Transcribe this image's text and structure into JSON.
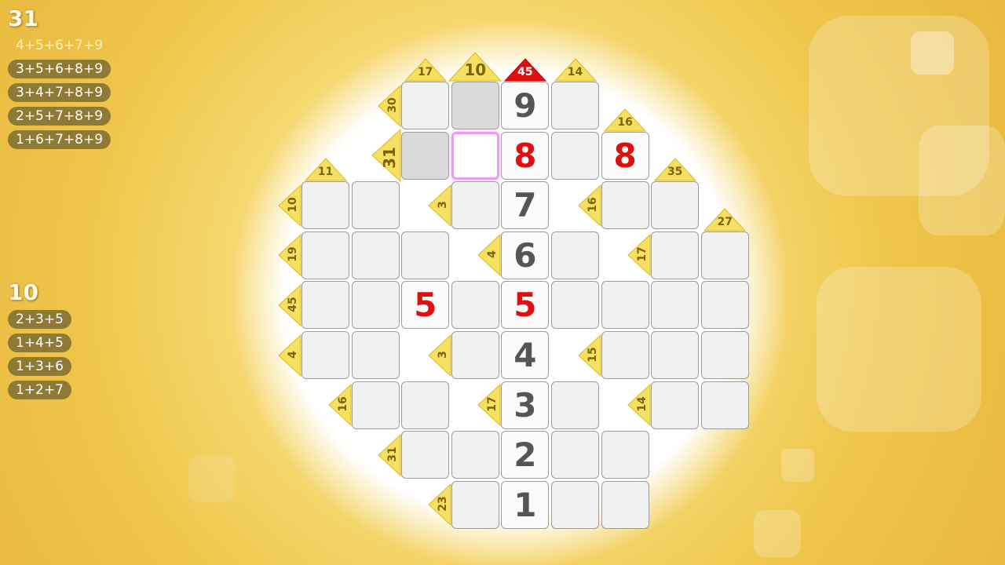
{
  "colors": {
    "clue_fill": "#f7df5f",
    "clue_highlight_fill": "#e01010",
    "cell_fill": "#f1f1f1",
    "cell_shaded": "#dadada",
    "cell_selected_border": "#e99cf2",
    "digit_red": "#e01010",
    "digit_gray": "#555555",
    "combo_pill": "#8e7a34"
  },
  "panels": [
    {
      "title": "31",
      "combos": [
        {
          "text": "4+5+6+7+9",
          "excluded": true
        },
        {
          "text": "3+5+6+8+9",
          "excluded": false
        },
        {
          "text": "3+4+7+8+9",
          "excluded": false
        },
        {
          "text": "2+5+7+8+9",
          "excluded": false
        },
        {
          "text": "1+6+7+8+9",
          "excluded": false
        }
      ]
    },
    {
      "title": "10",
      "combos": [
        {
          "text": "2+3+5",
          "excluded": false
        },
        {
          "text": "1+4+5",
          "excluded": false
        },
        {
          "text": "1+3+6",
          "excluded": false
        },
        {
          "text": "1+2+7",
          "excluded": false
        }
      ]
    }
  ],
  "cells": [
    {
      "r": 0,
      "c": 2,
      "v": "",
      "state": "empty"
    },
    {
      "r": 0,
      "c": 3,
      "v": "",
      "state": "shaded"
    },
    {
      "r": 0,
      "c": 4,
      "v": "9",
      "state": "gray"
    },
    {
      "r": 0,
      "c": 5,
      "v": "",
      "state": "empty"
    },
    {
      "r": 1,
      "c": 2,
      "v": "",
      "state": "shaded"
    },
    {
      "r": 1,
      "c": 3,
      "v": "",
      "state": "selected"
    },
    {
      "r": 1,
      "c": 4,
      "v": "8",
      "state": "red"
    },
    {
      "r": 1,
      "c": 5,
      "v": "",
      "state": "empty"
    },
    {
      "r": 1,
      "c": 6,
      "v": "8",
      "state": "red"
    },
    {
      "r": 2,
      "c": 0,
      "v": "",
      "state": "empty"
    },
    {
      "r": 2,
      "c": 1,
      "v": "",
      "state": "empty"
    },
    {
      "r": 2,
      "c": 3,
      "v": "",
      "state": "empty"
    },
    {
      "r": 2,
      "c": 4,
      "v": "7",
      "state": "gray"
    },
    {
      "r": 2,
      "c": 6,
      "v": "",
      "state": "empty"
    },
    {
      "r": 2,
      "c": 7,
      "v": "",
      "state": "empty"
    },
    {
      "r": 3,
      "c": 0,
      "v": "",
      "state": "empty"
    },
    {
      "r": 3,
      "c": 1,
      "v": "",
      "state": "empty"
    },
    {
      "r": 3,
      "c": 2,
      "v": "",
      "state": "empty"
    },
    {
      "r": 3,
      "c": 4,
      "v": "6",
      "state": "gray"
    },
    {
      "r": 3,
      "c": 5,
      "v": "",
      "state": "empty"
    },
    {
      "r": 3,
      "c": 7,
      "v": "",
      "state": "empty"
    },
    {
      "r": 3,
      "c": 8,
      "v": "",
      "state": "empty"
    },
    {
      "r": 4,
      "c": 0,
      "v": "",
      "state": "empty"
    },
    {
      "r": 4,
      "c": 1,
      "v": "",
      "state": "empty"
    },
    {
      "r": 4,
      "c": 2,
      "v": "5",
      "state": "red"
    },
    {
      "r": 4,
      "c": 3,
      "v": "",
      "state": "empty"
    },
    {
      "r": 4,
      "c": 4,
      "v": "5",
      "state": "red"
    },
    {
      "r": 4,
      "c": 5,
      "v": "",
      "state": "empty"
    },
    {
      "r": 4,
      "c": 6,
      "v": "",
      "state": "empty"
    },
    {
      "r": 4,
      "c": 7,
      "v": "",
      "state": "empty"
    },
    {
      "r": 4,
      "c": 8,
      "v": "",
      "state": "empty"
    },
    {
      "r": 5,
      "c": 0,
      "v": "",
      "state": "empty"
    },
    {
      "r": 5,
      "c": 1,
      "v": "",
      "state": "empty"
    },
    {
      "r": 5,
      "c": 3,
      "v": "",
      "state": "empty"
    },
    {
      "r": 5,
      "c": 4,
      "v": "4",
      "state": "gray"
    },
    {
      "r": 5,
      "c": 6,
      "v": "",
      "state": "empty"
    },
    {
      "r": 5,
      "c": 7,
      "v": "",
      "state": "empty"
    },
    {
      "r": 5,
      "c": 8,
      "v": "",
      "state": "empty"
    },
    {
      "r": 6,
      "c": 1,
      "v": "",
      "state": "empty"
    },
    {
      "r": 6,
      "c": 2,
      "v": "",
      "state": "empty"
    },
    {
      "r": 6,
      "c": 4,
      "v": "3",
      "state": "gray"
    },
    {
      "r": 6,
      "c": 5,
      "v": "",
      "state": "empty"
    },
    {
      "r": 6,
      "c": 7,
      "v": "",
      "state": "empty"
    },
    {
      "r": 6,
      "c": 8,
      "v": "",
      "state": "empty"
    },
    {
      "r": 7,
      "c": 2,
      "v": "",
      "state": "empty"
    },
    {
      "r": 7,
      "c": 3,
      "v": "",
      "state": "empty"
    },
    {
      "r": 7,
      "c": 4,
      "v": "2",
      "state": "gray"
    },
    {
      "r": 7,
      "c": 5,
      "v": "",
      "state": "empty"
    },
    {
      "r": 7,
      "c": 6,
      "v": "",
      "state": "empty"
    },
    {
      "r": 8,
      "c": 3,
      "v": "",
      "state": "empty"
    },
    {
      "r": 8,
      "c": 4,
      "v": "1",
      "state": "gray"
    },
    {
      "r": 8,
      "c": 5,
      "v": "",
      "state": "empty"
    },
    {
      "r": 8,
      "c": 6,
      "v": "",
      "state": "empty"
    }
  ],
  "column_clues": [
    {
      "c": 2,
      "r": 0,
      "text": "17",
      "size": "normal"
    },
    {
      "c": 3,
      "r": 0,
      "text": "10",
      "size": "large"
    },
    {
      "c": 4,
      "r": 0,
      "text": "45",
      "size": "normal",
      "highlight": true
    },
    {
      "c": 5,
      "r": 0,
      "text": "14",
      "size": "normal"
    },
    {
      "c": 6,
      "r": 1,
      "text": "16",
      "size": "normal"
    },
    {
      "c": 0,
      "r": 2,
      "text": "11",
      "size": "normal"
    },
    {
      "c": 7,
      "r": 2,
      "text": "35",
      "size": "normal"
    },
    {
      "c": 8,
      "r": 3,
      "text": "27",
      "size": "normal"
    }
  ],
  "row_clues": [
    {
      "r": 0,
      "c": 2,
      "text": "30",
      "size": "normal"
    },
    {
      "r": 1,
      "c": 2,
      "text": "31",
      "size": "large"
    },
    {
      "r": 2,
      "c": 0,
      "text": "10",
      "size": "normal"
    },
    {
      "r": 2,
      "c": 3,
      "text": "3",
      "size": "normal"
    },
    {
      "r": 2,
      "c": 6,
      "text": "16",
      "size": "normal"
    },
    {
      "r": 3,
      "c": 0,
      "text": "19",
      "size": "normal"
    },
    {
      "r": 3,
      "c": 4,
      "text": "4",
      "size": "normal"
    },
    {
      "r": 3,
      "c": 7,
      "text": "17",
      "size": "normal"
    },
    {
      "r": 4,
      "c": 0,
      "text": "45",
      "size": "normal"
    },
    {
      "r": 5,
      "c": 0,
      "text": "4",
      "size": "normal"
    },
    {
      "r": 5,
      "c": 3,
      "text": "3",
      "size": "normal"
    },
    {
      "r": 5,
      "c": 6,
      "text": "15",
      "size": "normal"
    },
    {
      "r": 6,
      "c": 1,
      "text": "16",
      "size": "normal"
    },
    {
      "r": 6,
      "c": 4,
      "text": "17",
      "size": "normal"
    },
    {
      "r": 6,
      "c": 7,
      "text": "14",
      "size": "normal"
    },
    {
      "r": 7,
      "c": 2,
      "text": "31",
      "size": "normal"
    },
    {
      "r": 8,
      "c": 3,
      "text": "23",
      "size": "normal"
    }
  ]
}
